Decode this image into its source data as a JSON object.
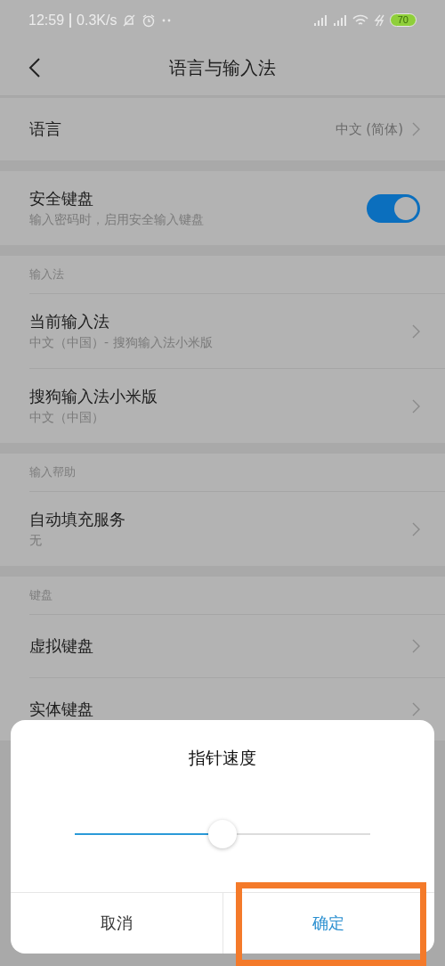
{
  "status_bar": {
    "time": "12:59",
    "speed": "0.3K/s",
    "battery": "70"
  },
  "header": {
    "title": "语言与输入法"
  },
  "sections": [
    {
      "items": [
        {
          "kind": "link",
          "title": "语言",
          "value": "中文 (简体)"
        }
      ]
    },
    {
      "items": [
        {
          "kind": "toggle",
          "title": "安全键盘",
          "subtitle": "输入密码时，启用安全输入键盘",
          "on": true
        }
      ]
    },
    {
      "header": "输入法",
      "items": [
        {
          "kind": "link",
          "title": "当前输入法",
          "subtitle": "中文（中国）- 搜狗输入法小米版"
        },
        {
          "kind": "link",
          "title": "搜狗输入法小米版",
          "subtitle": "中文（中国）"
        }
      ]
    },
    {
      "header": "输入帮助",
      "items": [
        {
          "kind": "link",
          "title": "自动填充服务",
          "subtitle": "无"
        }
      ]
    },
    {
      "header": "键盘",
      "items": [
        {
          "kind": "link",
          "title": "虚拟键盘"
        },
        {
          "kind": "link",
          "title": "实体键盘"
        }
      ]
    }
  ],
  "dialog": {
    "title": "指针速度",
    "slider": {
      "level": 0.5
    },
    "buttons": [
      {
        "label": "取消",
        "kind": "cancel",
        "highlighted": false
      },
      {
        "label": "确定",
        "kind": "confirm",
        "highlighted": true
      }
    ]
  }
}
